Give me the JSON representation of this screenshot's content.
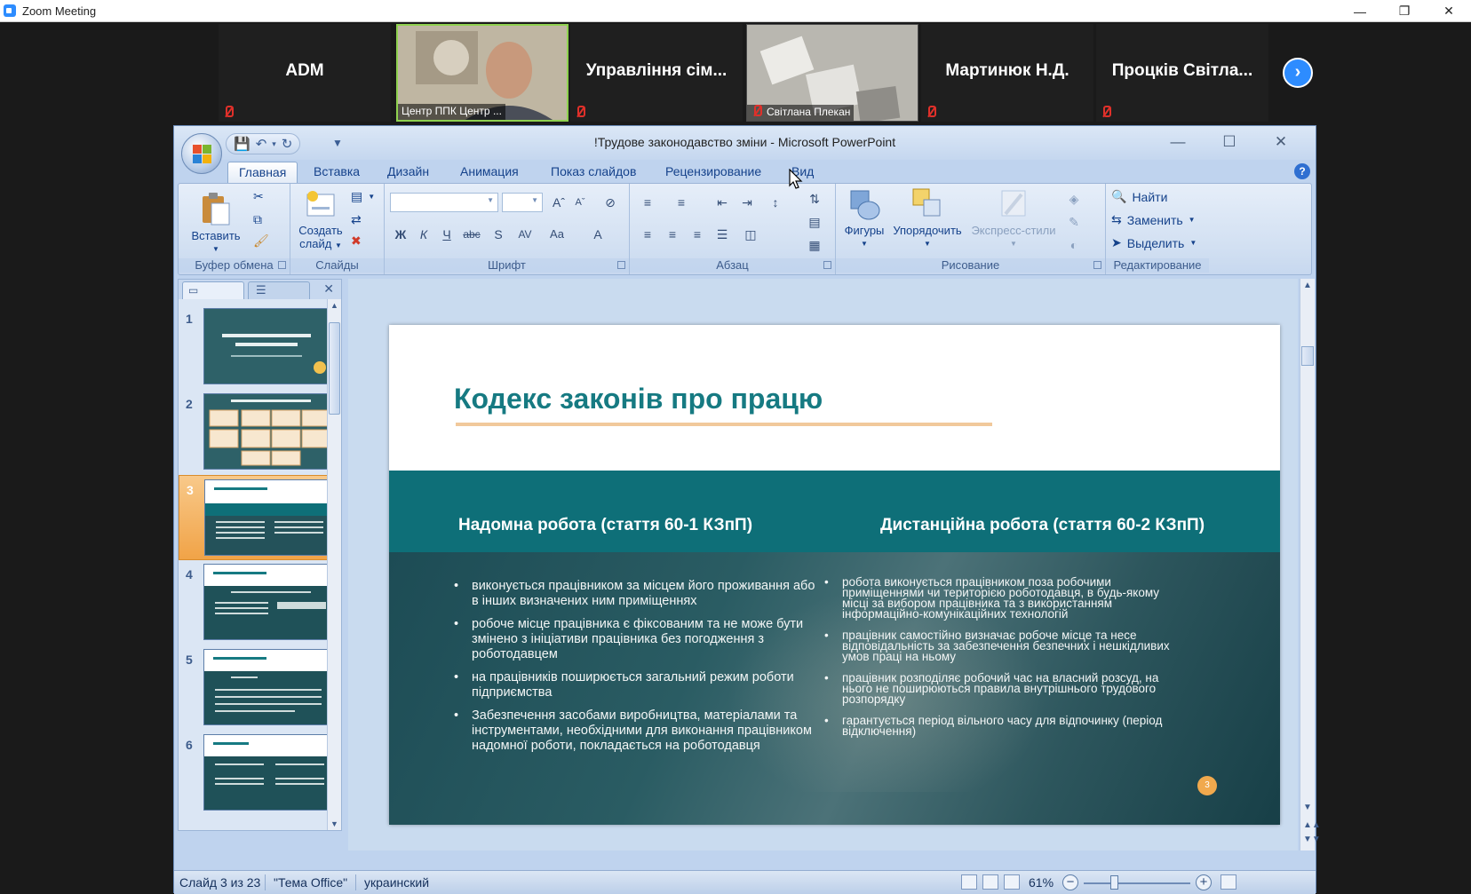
{
  "zoom": {
    "window_title": "Zoom Meeting",
    "participants": [
      {
        "name": "ADM",
        "muted": true,
        "video": false
      },
      {
        "name": "Центр ППК Центр ...",
        "muted": false,
        "video": true,
        "active_speaker": true
      },
      {
        "name": "Управління сім...",
        "muted": true,
        "video": false
      },
      {
        "name": "Світлана Плекан",
        "muted": true,
        "video": true
      },
      {
        "name": "Мартинюк Н.Д.",
        "muted": true,
        "video": false
      },
      {
        "name": "Процків Світла...",
        "muted": true,
        "video": false
      }
    ]
  },
  "ppt": {
    "window_title": "!Трудове законодавство зміни - Microsoft PowerPoint",
    "tabs": [
      "Главная",
      "Вставка",
      "Дизайн",
      "Анимация",
      "Показ слайдов",
      "Рецензирование",
      "Вид"
    ],
    "active_tab": "Главная",
    "ribbon": {
      "clipboard": {
        "group": "Буфер обмена",
        "paste": "Вставить"
      },
      "slides": {
        "group": "Слайды",
        "new_slide_1": "Создать",
        "new_slide_2": "слайд"
      },
      "font": {
        "group": "Шрифт"
      },
      "paragraph": {
        "group": "Абзац"
      },
      "drawing": {
        "group": "Рисование",
        "shapes": "Фигуры",
        "arrange": "Упорядочить",
        "quick_styles": "Экспресс-стили"
      },
      "editing": {
        "group": "Редактирование",
        "find": "Найти",
        "replace": "Заменить",
        "select": "Выделить"
      }
    },
    "thumbnails": [
      "1",
      "2",
      "3",
      "4",
      "5",
      "6"
    ],
    "selected_slide": 3,
    "slide": {
      "title": "Кодекс законів про працю",
      "left_heading": "Надомна робота (стаття 60-1 КЗпП)",
      "right_heading": "Дистанційна робота (стаття 60-2 КЗпП)",
      "left_bullets": [
        "виконується працівником за місцем його проживання або в інших визначених ним приміщеннях",
        "робоче місце працівника є фіксованим та не може бути змінено з ініціативи працівника без погодження з роботодавцем",
        "на працівників поширюється загальний режим роботи підприємства",
        "Забезпечення засобами виробництва, матеріалами та інструментами, необхідними для виконання працівником надомної роботи, покладається на роботодавця"
      ],
      "right_bullets": [
        "робота виконується працівником поза робочими приміщеннями чи територією роботодавця, в будь-якому місці за вибором працівника та з використанням інформаційно-комунікаційних технологій",
        "працівник самостійно визначає робоче місце та несе відповідальність за забезпечення безпечних і нешкідливих умов праці на ньому",
        "працівник розподіляє робочий час на власний розсуд, на нього не поширюються правила внутрішнього трудового розпорядку",
        "гарантується період вільного часу для відпочинку (період відключення)"
      ],
      "page_number": "3"
    },
    "status": {
      "slide_info": "Слайд 3 из 23",
      "theme": "\"Тема Office\"",
      "language": "украинский",
      "zoom": "61%"
    },
    "colors": {
      "teal": "#0e6f78",
      "title": "#167a82",
      "accent": "#f1a94d"
    }
  }
}
